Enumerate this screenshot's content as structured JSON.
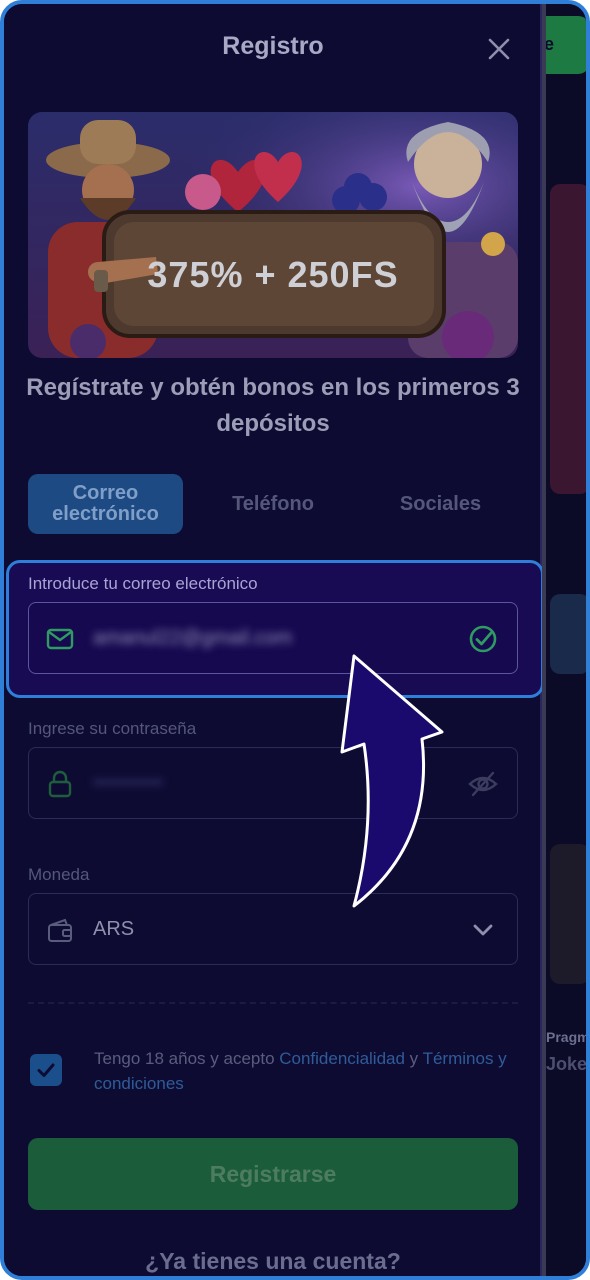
{
  "modal": {
    "title": "Registro",
    "banner_text": "375% + 250FS",
    "headline": "Regístrate y obtén bonos en los primeros 3 depósitos",
    "tabs": [
      {
        "label": "Correo electrónico",
        "active": true
      },
      {
        "label": "Teléfono",
        "active": false
      },
      {
        "label": "Sociales",
        "active": false
      }
    ],
    "email": {
      "label": "Introduce tu correo electrónico",
      "value": "amanul22@gmail.com",
      "icon": "mail-icon",
      "status_icon": "check-circle-icon"
    },
    "password": {
      "label": "Ingrese su contraseña",
      "value": "••••••••••",
      "icon": "lock-icon",
      "toggle_icon": "eye-off-icon"
    },
    "currency": {
      "label": "Moneda",
      "value": "ARS",
      "icon": "wallet-icon",
      "dropdown_icon": "chevron-down-icon"
    },
    "consent": {
      "checked": true,
      "prefix": "Tengo 18 años y acepto ",
      "privacy_link": "Confidencialidad",
      "conjunction": " y ",
      "terms_link": "Términos y condiciones"
    },
    "register_label": "Registrarse",
    "have_account": "¿Ya tienes una cuenta?"
  },
  "colors": {
    "modal_bg": "#0e0b33",
    "highlight_border": "#2f7fd9",
    "accent_green": "#1b5c3a",
    "link": "#2e5c98"
  }
}
